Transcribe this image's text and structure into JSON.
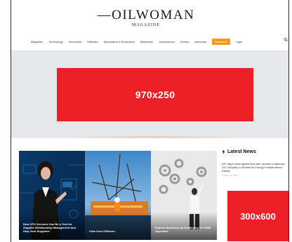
{
  "header": {
    "logo_main": "OILWOMAN",
    "logo_sub": "MAGAZINE"
  },
  "nav": {
    "items": [
      "Magazine",
      "Technology",
      "Innovation",
      "Software",
      "Exploration & Production",
      "Midstream",
      "Downstream",
      "Events",
      "Advertise",
      "Subscribe",
      "Login"
    ]
  },
  "ads": {
    "leaderboard": "970x250",
    "sidebar": "300x600"
  },
  "featured": [
    {
      "caption": "How CFO Services Can Be a Tool for Supplier Relationship Management and Help Your Suppliers"
    },
    {
      "caption": "View from Offshore"
    },
    {
      "caption": "Improve Business by Employing the DRM Approach"
    }
  ],
  "latest_news": {
    "heading": "Latest News",
    "icon": "bolt-icon",
    "items": [
      {
        "title": "API Signs New Agreement with Ukraine's National Oil Company to Bolster its Energy Independence Efforts",
        "date": "October 00, 2023"
      }
    ]
  },
  "colors": {
    "ad_red": "#ec1f26",
    "subscribe_orange": "#f39a1e",
    "band_gray": "#e7e8eb"
  }
}
